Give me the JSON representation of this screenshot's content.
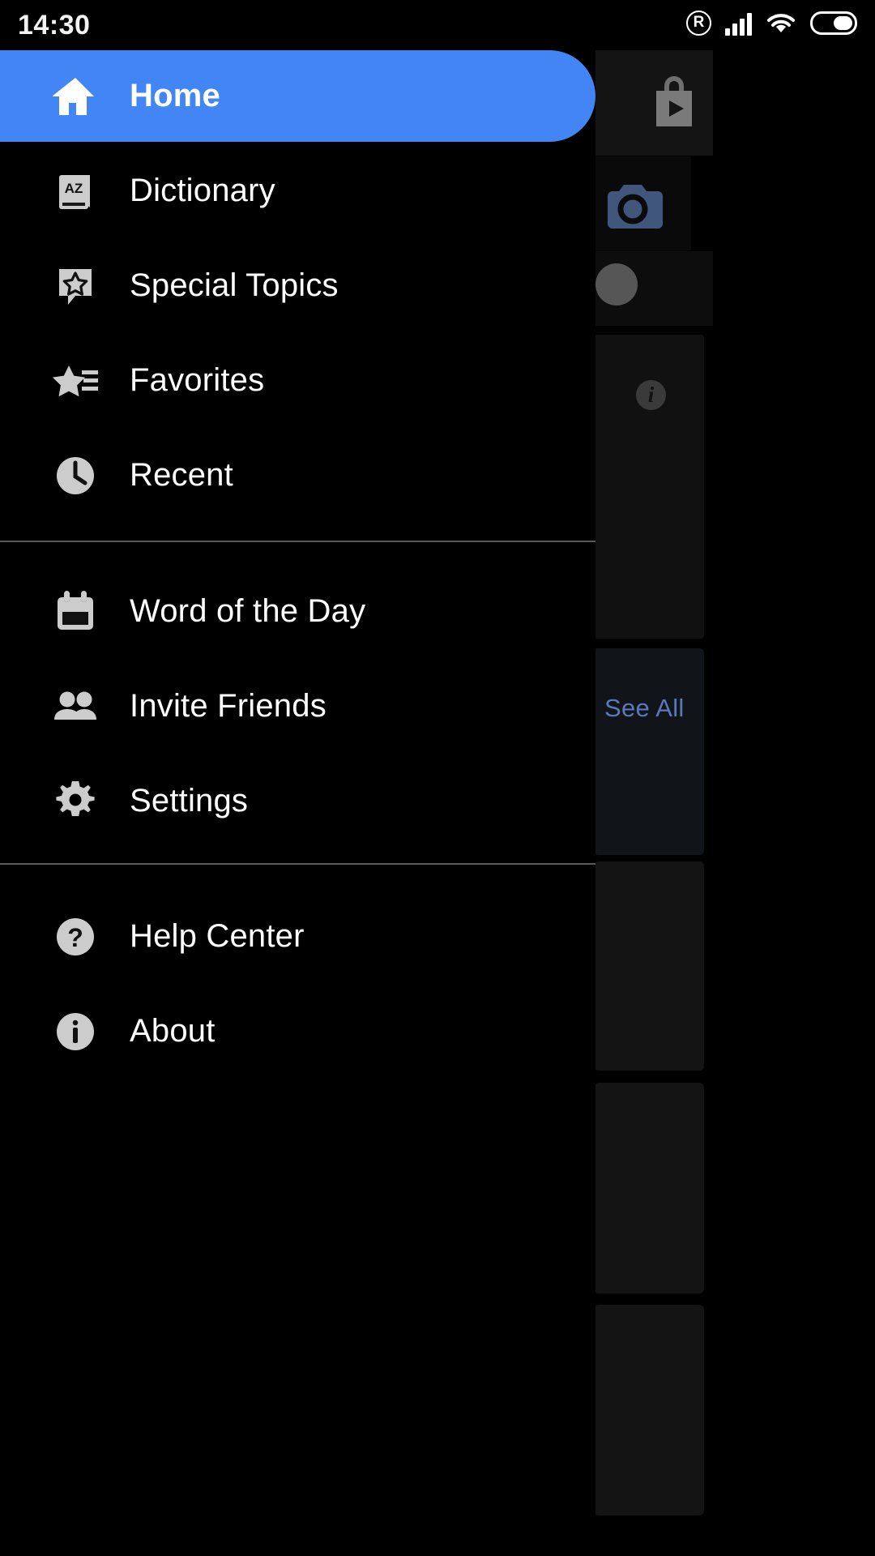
{
  "status_bar": {
    "time": "14:30",
    "icons": [
      {
        "name": "registered-trademark-icon",
        "glyph": "R"
      },
      {
        "name": "cellular-signal-icon",
        "bars": 4
      },
      {
        "name": "wifi-icon",
        "strength": "full"
      },
      {
        "name": "battery-icon",
        "level_percent": 50
      }
    ]
  },
  "drawer": {
    "groups": [
      {
        "id": "primary",
        "items": [
          {
            "label": "Home",
            "icon": "home-icon",
            "selected": true
          },
          {
            "label": "Dictionary",
            "icon": "dictionary-book-icon",
            "selected": false
          },
          {
            "label": "Special Topics",
            "icon": "star-bubble-icon",
            "selected": false
          },
          {
            "label": "Favorites",
            "icon": "star-list-icon",
            "selected": false
          },
          {
            "label": "Recent",
            "icon": "clock-icon",
            "selected": false
          }
        ]
      },
      {
        "id": "secondary",
        "items": [
          {
            "label": "Word of the Day",
            "icon": "calendar-icon",
            "selected": false
          },
          {
            "label": "Invite Friends",
            "icon": "people-icon",
            "selected": false
          },
          {
            "label": "Settings",
            "icon": "gear-icon",
            "selected": false
          }
        ]
      },
      {
        "id": "tertiary",
        "items": [
          {
            "label": "Help Center",
            "icon": "question-circle-icon",
            "selected": false
          },
          {
            "label": "About",
            "icon": "info-circle-icon",
            "selected": false
          }
        ]
      }
    ]
  },
  "background": {
    "see_all_label": "See All",
    "icons": [
      {
        "name": "play-store-bag-icon"
      },
      {
        "name": "camera-icon"
      },
      {
        "name": "avatar-icon"
      },
      {
        "name": "info-circle-icon"
      }
    ]
  },
  "colors": {
    "accent_blue": "#4285f4",
    "drawer_background": "#000000",
    "icon_gray": "#cccccc",
    "divider": "#5a5a5a",
    "see_all_blue": "#5a79b8",
    "camera_blue": "#41567c"
  }
}
